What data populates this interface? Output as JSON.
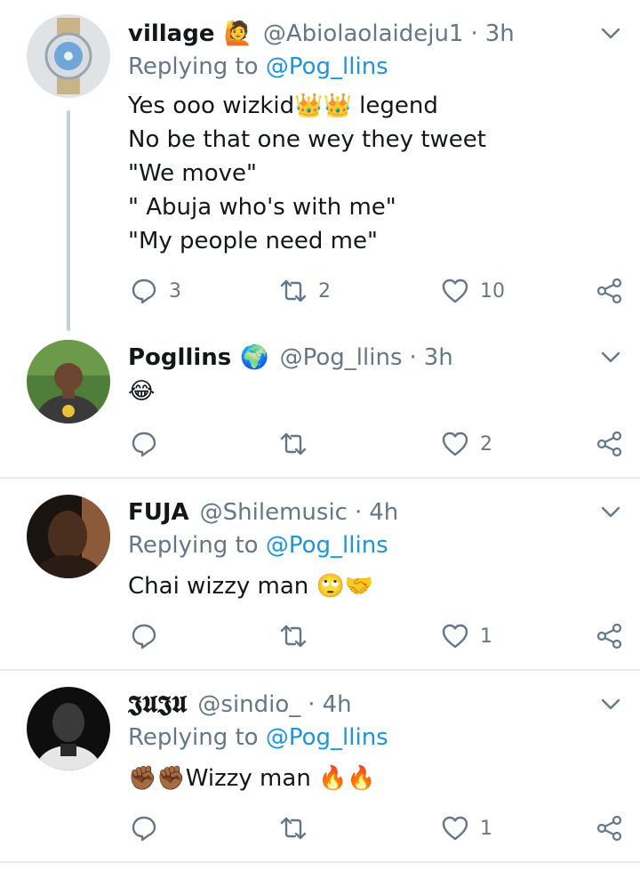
{
  "colors": {
    "link": "#1b95e0",
    "muted": "#657786",
    "text": "#14171a",
    "divider": "#e6ecf0"
  },
  "tweets": [
    {
      "name": "village",
      "name_emoji": "🙋",
      "handle": "@Abiolaolaideju1",
      "time": "3h",
      "reply_prefix": "Replying to",
      "reply_handle": "@Pog_llins",
      "lines": [
        "Yes ooo wizkid👑👑 legend",
        "No be that one wey they tweet",
        "\"We move\"",
        "\" Abuja who's with me\"",
        "\"My people need me\""
      ],
      "replies": "3",
      "retweets": "2",
      "likes": "10"
    },
    {
      "name": "Pogllins",
      "name_emoji": "🌍",
      "handle": "@Pog_llins",
      "time": "3h",
      "lines": [
        "😂"
      ],
      "replies": "",
      "retweets": "",
      "likes": "2"
    },
    {
      "name": "FUJA",
      "handle": "@Shilemusic",
      "time": "4h",
      "reply_prefix": "Replying to",
      "reply_handle": "@Pog_llins",
      "lines": [
        "Chai wizzy man 🙄🤝"
      ],
      "replies": "",
      "retweets": "",
      "likes": "1"
    },
    {
      "name": "𝕵𝖀𝕵𝖀",
      "handle": "@sindio_",
      "time": "4h",
      "reply_prefix": "Replying to",
      "reply_handle": "@Pog_llins",
      "lines": [
        "✊🏾✊🏾Wizzy man 🔥🔥"
      ],
      "replies": "",
      "retweets": "",
      "likes": "1"
    }
  ],
  "icons": {
    "reply": "reply-icon",
    "retweet": "retweet-icon",
    "like": "heart-icon",
    "share": "share-icon",
    "more": "chevron-down-icon"
  }
}
